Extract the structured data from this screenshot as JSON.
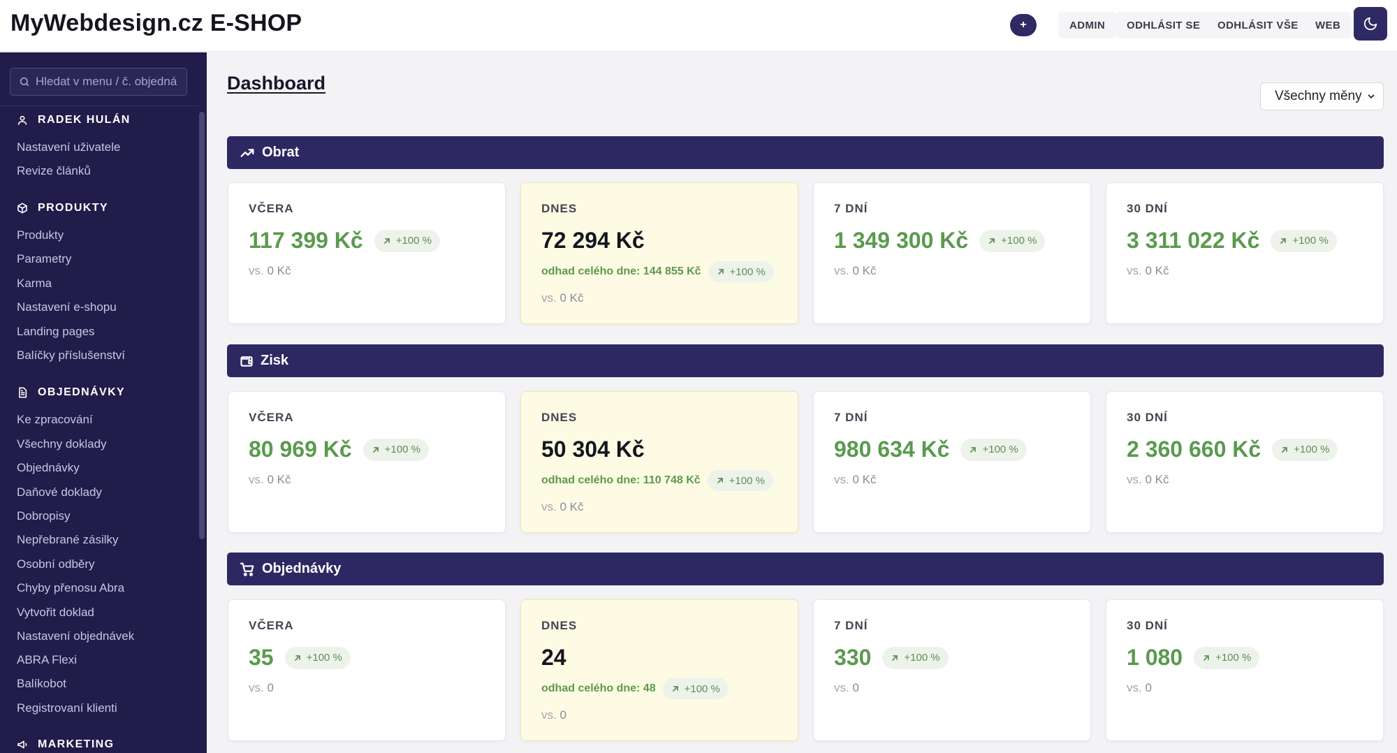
{
  "header": {
    "brand": "MyWebdesign.cz E-SHOP",
    "plus_label": "+",
    "nav": [
      "ADMIN",
      "ODHLÁSIT SE",
      "ODHLÁSIT VŠE",
      "WEB"
    ]
  },
  "sidebar": {
    "search_placeholder": "Hledat v menu / č. objedná",
    "sections": [
      {
        "title": "RADEK HULÁN",
        "icon": "user-icon",
        "items": [
          "Nastavení uživatele",
          "Revize článků"
        ]
      },
      {
        "title": "PRODUKTY",
        "icon": "box-icon",
        "items": [
          "Produkty",
          "Parametry",
          "Karma",
          "Nastavení e-shopu",
          "Landing pages",
          "Balíčky příslušenství"
        ]
      },
      {
        "title": "OBJEDNÁVKY",
        "icon": "document-icon",
        "items": [
          "Ke zpracování",
          "Všechny doklady",
          "Objednávky",
          "Daňové doklady",
          "Dobropisy",
          "Nepřebrané zásilky",
          "Osobní odběry",
          "Chyby přenosu Abra",
          "Vytvořit doklad",
          "Nastavení objednávek",
          "ABRA Flexi",
          "Balíkobot",
          "Registrovaní klienti"
        ]
      },
      {
        "title": "MARKETING",
        "icon": "megaphone-icon",
        "items": []
      }
    ]
  },
  "main": {
    "title": "Dashboard",
    "currency_select": "Všechny měny",
    "vs_prefix": "vs.",
    "estimate_prefix": "odhad celého dne:",
    "groups": [
      {
        "title": "Obrat",
        "icon": "trend-up-icon",
        "cards": [
          {
            "label": "VČERA",
            "value": "117 399 Kč",
            "change": "+100 %",
            "vs": "0 Kč"
          },
          {
            "label": "DNES",
            "value": "72 294 Kč",
            "estimate": "144 855 Kč",
            "change": "+100 %",
            "vs": "0 Kč"
          },
          {
            "label": "7 DNÍ",
            "value": "1 349 300 Kč",
            "change": "+100 %",
            "vs": "0 Kč"
          },
          {
            "label": "30 DNÍ",
            "value": "3 311 022 Kč",
            "change": "+100 %",
            "vs": "0 Kč"
          }
        ]
      },
      {
        "title": "Zisk",
        "icon": "wallet-icon",
        "cards": [
          {
            "label": "VČERA",
            "value": "80 969 Kč",
            "change": "+100 %",
            "vs": "0 Kč"
          },
          {
            "label": "DNES",
            "value": "50 304 Kč",
            "estimate": "110 748 Kč",
            "change": "+100 %",
            "vs": "0 Kč"
          },
          {
            "label": "7 DNÍ",
            "value": "980 634 Kč",
            "change": "+100 %",
            "vs": "0 Kč"
          },
          {
            "label": "30 DNÍ",
            "value": "2 360 660 Kč",
            "change": "+100 %",
            "vs": "0 Kč"
          }
        ]
      },
      {
        "title": "Objednávky",
        "icon": "cart-icon",
        "cards": [
          {
            "label": "VČERA",
            "value": "35",
            "change": "+100 %",
            "vs": "0"
          },
          {
            "label": "DNES",
            "value": "24",
            "estimate": "48",
            "change": "+100 %",
            "vs": "0"
          },
          {
            "label": "7 DNÍ",
            "value": "330",
            "change": "+100 %",
            "vs": "0"
          },
          {
            "label": "30 DNÍ",
            "value": "1 080",
            "change": "+100 %",
            "vs": "0"
          }
        ]
      }
    ]
  },
  "colors": {
    "sidebar": "#221c4a",
    "band": "#2d2862",
    "positive": "#5a9a4e",
    "today_card": "#fdfbe3"
  }
}
